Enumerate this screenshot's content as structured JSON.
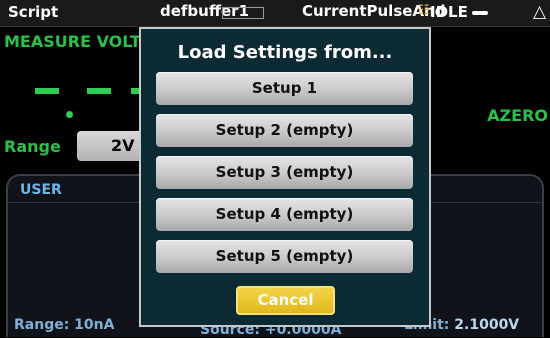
{
  "statusbar": {
    "script_label": "Script",
    "buffer": "defbuffer1",
    "script_name": "CurrentPulseAnd",
    "state": "IDLE",
    "warning_icon": "warning-triangle-icon",
    "network_icon": "network-icon"
  },
  "measure": {
    "title": "MEASURE VOLT",
    "azero": "AZERO",
    "range_label": "Range",
    "range_value": "2V"
  },
  "user_panel": {
    "tab": "USER",
    "range_text": "Range: 10nA",
    "source_text": "Source: +0.0000A",
    "limit_key": "Limit:",
    "limit_value": " 2.1000V"
  },
  "dialog": {
    "title": "Load Settings from...",
    "options": [
      "Setup 1",
      "Setup 2 (empty)",
      "Setup 3 (empty)",
      "Setup 4 (empty)",
      "Setup 5 (empty)"
    ],
    "cancel": "Cancel"
  },
  "colors": {
    "measure_green": "#27c14c",
    "dialog_bg": "#0b2a33",
    "cancel_yellow": "#e0b81a",
    "user_blue": "#6fb6e8"
  }
}
